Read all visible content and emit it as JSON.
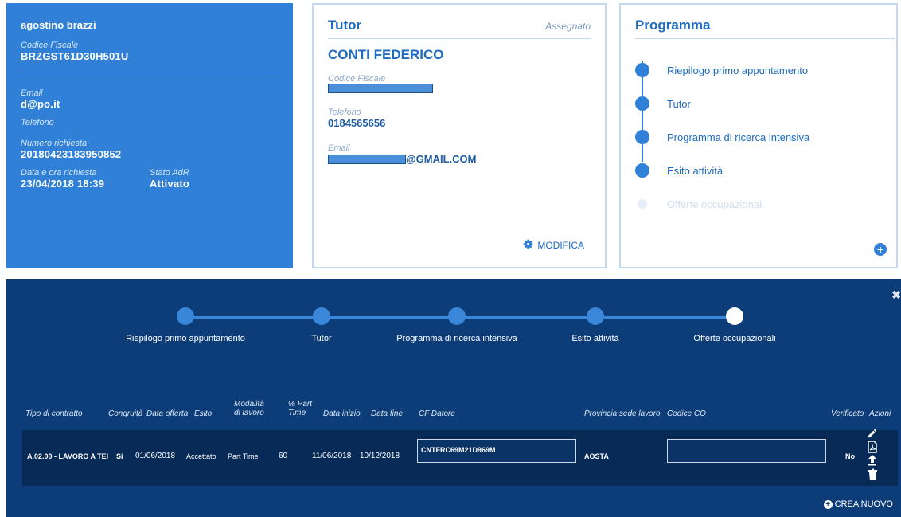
{
  "user_card": {
    "name": "agostino brazzi",
    "cf_label": "Codice Fiscale",
    "cf_value": "BRZGST61D30H501U",
    "email_label": "Email",
    "email_value": "d@po.it",
    "phone_label": "Telefono",
    "request_num_label": "Numero richiesta",
    "request_num_value": "20180423183950852",
    "date_label": "Data e ora richiesta",
    "date_value": "23/04/2018 18:39",
    "state_label": "Stato AdR",
    "state_value": "Attivato"
  },
  "tutor_card": {
    "title": "Tutor",
    "status": "Assegnato",
    "name": "CONTI FEDERICO",
    "cf_label": "Codice Fiscale",
    "phone_label": "Telefono",
    "phone_value": "0184565656",
    "email_label": "Email",
    "email_suffix": "@GMAIL.COM",
    "modify_label": "MODIFICA"
  },
  "program_card": {
    "title": "Programma",
    "steps": [
      {
        "label": "Riepilogo primo appuntamento",
        "active": true
      },
      {
        "label": "Tutor",
        "active": true
      },
      {
        "label": "Programma di ricerca intensiva",
        "active": true
      },
      {
        "label": "Esito attività",
        "active": true
      },
      {
        "label": "Offerte occupazionali",
        "active": false
      }
    ]
  },
  "panel": {
    "steps": [
      "Riepilogo primo appuntamento",
      "Tutor",
      "Programma di ricerca intensiva",
      "Esito attività",
      "Offerte occupazionali"
    ],
    "current_step": 4,
    "columns": {
      "tipo": "Tipo di contratto",
      "congruita": "Congruità",
      "data_offerta": "Data offerta",
      "esito": "Esito",
      "modalita": "Modalità di lavoro",
      "part_time": "% Part Time",
      "data_inizio": "Data inizio",
      "data_fine": "Data fine",
      "cf_datore": "CF Datore",
      "provincia": "Provincia sede lavoro",
      "codice_co": "Codice CO",
      "verificato": "Verificato",
      "azioni": "Azioni"
    },
    "row": {
      "tipo": "A.02.00 - LAVORO A TEI",
      "congruita": "Si",
      "data_offerta": "01/06/2018",
      "esito": "Accettato",
      "modalita": "Part Time",
      "part_time": "60",
      "data_inizio": "11/06/2018",
      "data_fine": "10/12/2018",
      "cf_datore": "CNTFRC69M21D969M",
      "provincia": "AOSTA",
      "codice_co": "",
      "verificato": "No"
    },
    "create_label": "CREA NUOVO"
  },
  "colors": {
    "user_card_bg": "#2f80d6",
    "accent_blue": "#1e6bc1",
    "panel_bg": "#0c3d78"
  }
}
